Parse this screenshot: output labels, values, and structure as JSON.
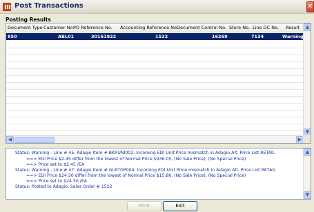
{
  "window": {
    "title": "Post Transactions",
    "close_glyph": "✕"
  },
  "section": {
    "label": "Posting Results"
  },
  "grid": {
    "columns": [
      "Document Type",
      "Customer No.",
      "PO Reference No.",
      "Accounting Reference No.",
      "Document Control No.",
      "Store No.",
      "Line DC No.",
      "Result"
    ],
    "rows": [
      {
        "document_type": "850",
        "customer_no": "ABL01",
        "po_reference_no": "30161922",
        "accounting_reference_no": "1522",
        "document_control_no": "16269",
        "store_no": "7134",
        "line_dc_no": "",
        "result": "Warning"
      }
    ]
  },
  "status_lines": [
    "Status: Warning - Line # 45: Adagio Item # BKRUNI002: Incoming EDI Unit Price mismatch in Adagio Alt. Price List RETAIL",
    "==> EDI Price $2.45 differ from the lowest of Normal Price $936.05, (No Sale Price), (No Special Price)",
    "==> Price set to $2.45 /EA",
    "Status: Warning - Line # 47: Adagio Item # GLBTOP004: Incoming EDI Unit Price mismatch in Adagio Alt. Price List RETAIL",
    "==> EDI Price $24.50 differ from the lowest of Normal Price $15.86, (No Sale Price), (No Special Price)",
    "==> Price set to $24.50 /EA",
    "Status: Posted to Adagio. Sales Order # 1522"
  ],
  "buttons": {
    "print_label": "Print",
    "exit_label": "Exit"
  },
  "scroll": {
    "up": "▲",
    "down": "▼",
    "left": "◀",
    "right": "▶"
  }
}
